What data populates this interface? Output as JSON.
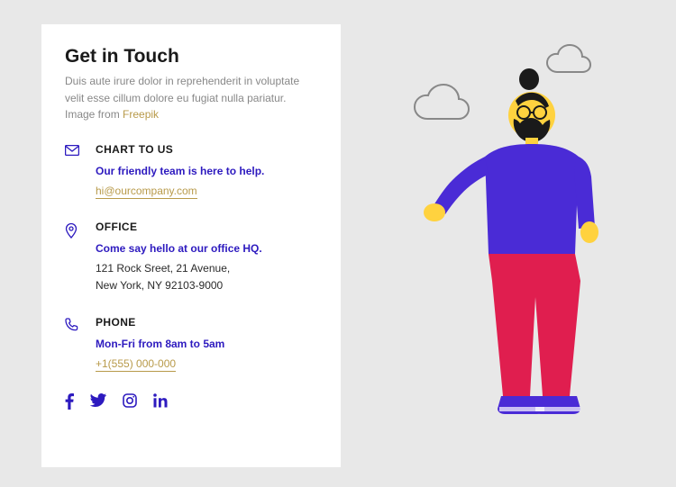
{
  "title": "Get in Touch",
  "intro": "Duis aute irure dolor in reprehenderit in voluptate velit esse cillum dolore eu fugiat nulla pariatur. Image from ",
  "intro_link_label": "Freepik",
  "sections": {
    "chart": {
      "title": "CHART TO US",
      "sub": "Our friendly team is here to help.",
      "link": "hi@ourcompany.com"
    },
    "office": {
      "title": "OFFICE",
      "sub": "Come say hello at our office HQ.",
      "line1": "121 Rock Sreet, 21 Avenue,",
      "line2": "New York, NY 92103-9000"
    },
    "phone": {
      "title": "PHONE",
      "sub": "Mon-Fri from 8am to 5am",
      "link": "+1(555) 000-000"
    }
  },
  "colors": {
    "accent": "#2d1abf",
    "gold": "#b89a4a",
    "red": "#e01e4f",
    "yellow": "#ffd23f"
  }
}
